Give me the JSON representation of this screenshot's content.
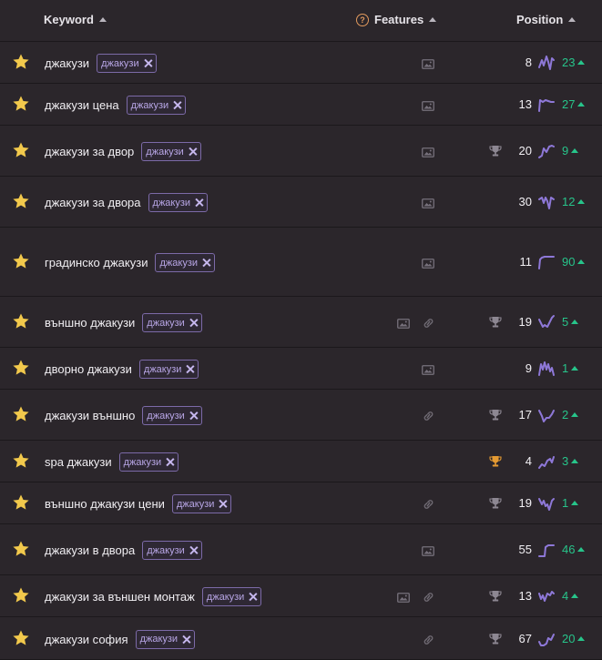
{
  "header": {
    "keyword_label": "Keyword",
    "features_label": "Features",
    "position_label": "Position"
  },
  "rows": [
    {
      "keyword": "джакузи",
      "tag": "джакузи",
      "position": "8",
      "change": "23",
      "trophy": false,
      "features": [
        "image"
      ]
    },
    {
      "keyword": "джакузи цена",
      "tag": "джакузи",
      "position": "13",
      "change": "27",
      "trophy": false,
      "features": [
        "image"
      ]
    },
    {
      "keyword": "джакузи за двор",
      "tag": "джакузи",
      "position": "20",
      "change": "9",
      "trophy": true,
      "features": [
        "image"
      ]
    },
    {
      "keyword": "джакузи за двора",
      "tag": "джакузи",
      "position": "30",
      "change": "12",
      "trophy": false,
      "features": [
        "image"
      ]
    },
    {
      "keyword": "градинско джакузи",
      "tag": "джакузи",
      "position": "11",
      "change": "90",
      "trophy": false,
      "features": [
        "image"
      ]
    },
    {
      "keyword": "външно джакузи",
      "tag": "джакузи",
      "position": "19",
      "change": "5",
      "trophy": true,
      "features": [
        "image",
        "link"
      ]
    },
    {
      "keyword": "дворно джакузи",
      "tag": "джакузи",
      "position": "9",
      "change": "1",
      "trophy": false,
      "features": [
        "image"
      ]
    },
    {
      "keyword": "джакузи външно",
      "tag": "джакузи",
      "position": "17",
      "change": "2",
      "trophy": true,
      "features": [
        "link"
      ]
    },
    {
      "keyword": "spa джакузи",
      "tag": "джакузи",
      "position": "4",
      "change": "3",
      "trophy": true,
      "trophy_gold": true,
      "features": []
    },
    {
      "keyword": "външно джакузи цени",
      "tag": "джакузи",
      "position": "19",
      "change": "1",
      "trophy": true,
      "features": [
        "link"
      ]
    },
    {
      "keyword": "джакузи в двора",
      "tag": "джакузи",
      "position": "55",
      "change": "46",
      "trophy": false,
      "features": [
        "image"
      ]
    },
    {
      "keyword": "джакузи за външен монтаж",
      "tag": "джакузи",
      "position": "13",
      "change": "4",
      "trophy": true,
      "features": [
        "image",
        "link"
      ]
    },
    {
      "keyword": "джакузи софия",
      "tag": "джакузи",
      "position": "67",
      "change": "20",
      "trophy": true,
      "features": [
        "link"
      ]
    }
  ],
  "colors": {
    "background": "#2b262b",
    "star": "#f2c94c",
    "tag_border": "#7c6aa8",
    "change_up": "#27c48a",
    "sparkline": "#8e78d8",
    "trophy": "#8d8792",
    "trophy_gold": "#e49a32"
  }
}
